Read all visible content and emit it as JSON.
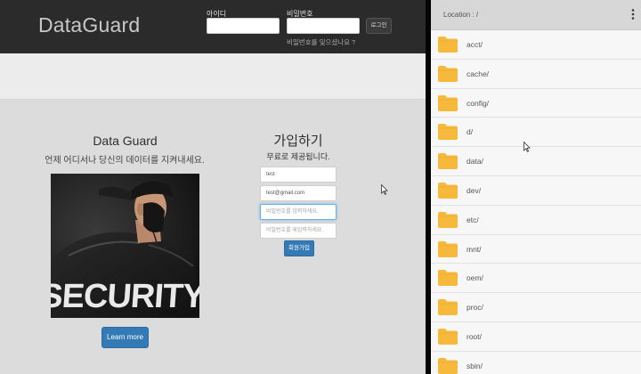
{
  "web": {
    "brand": "DataGuard",
    "login": {
      "id_label": "아이디",
      "pw_label": "비밀번호",
      "button": "로그인",
      "forgot": "비밀번호를 잊으셨나요 ?"
    },
    "hero": {
      "title": "Data Guard",
      "subtitle": "언제 어디서나 당신의 데이터를 지켜내세요.",
      "button": "Learn more",
      "photo_text": "SECURITY"
    },
    "signup": {
      "title": "가입하기",
      "subtitle": "무료로 제공됩니다.",
      "name_value": "test",
      "email_value": "test@gmail.com",
      "password_placeholder": "비밀번호를 입력하세요.",
      "password_confirm_placeholder": "비밀번호를 재입력하세요.",
      "button": "회원가입"
    }
  },
  "file_manager": {
    "location": "Location : /",
    "menu_icon": "more-vert-icon",
    "folder_icon": "folder-icon",
    "folder_color": "#f6b93b",
    "folders": [
      "acct/",
      "cache/",
      "config/",
      "d/",
      "data/",
      "dev/",
      "etc/",
      "mnt/",
      "oem/",
      "proc/",
      "root/",
      "sbin/"
    ]
  },
  "colors": {
    "navbar": "#2b2b2b",
    "primary_button": "#337ab7",
    "page_background": "#dcdcdc"
  }
}
